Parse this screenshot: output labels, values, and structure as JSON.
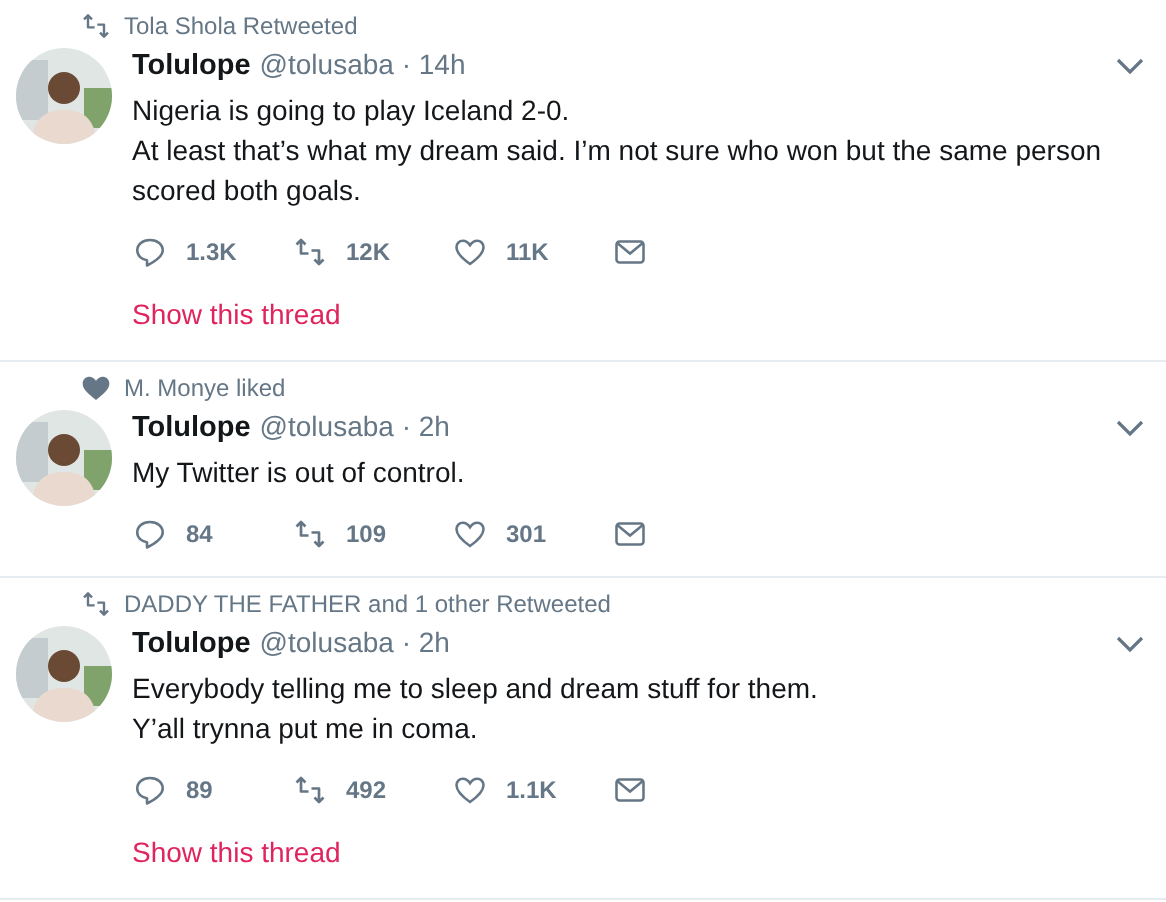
{
  "tweets": [
    {
      "context": {
        "kind": "retweet",
        "text": "Tola Shola Retweeted"
      },
      "name": "Tolulope",
      "meta": "@tolusaba · 14h",
      "lines": [
        "Nigeria is going to play Iceland 2-0.",
        "At least that’s what my dream said. I’m not sure who won but the same person scored both goals."
      ],
      "replies": "1.3K",
      "retweets": "12K",
      "likes": "11K",
      "thread_link": "Show this thread"
    },
    {
      "context": {
        "kind": "like",
        "text": "M. Monye liked"
      },
      "name": "Tolulope",
      "meta": "@tolusaba · 2h",
      "lines": [
        "My Twitter is out of control."
      ],
      "replies": "84",
      "retweets": "109",
      "likes": "301"
    },
    {
      "context": {
        "kind": "retweet",
        "text": "DADDY THE FATHER and 1 other Retweeted"
      },
      "name": "Tolulope",
      "meta": "@tolusaba · 2h",
      "lines": [
        "Everybody telling me to sleep and dream stuff for them.",
        "Y’all trynna put me in coma."
      ],
      "replies": "89",
      "retweets": "492",
      "likes": "1.1K",
      "thread_link": "Show this thread"
    }
  ]
}
